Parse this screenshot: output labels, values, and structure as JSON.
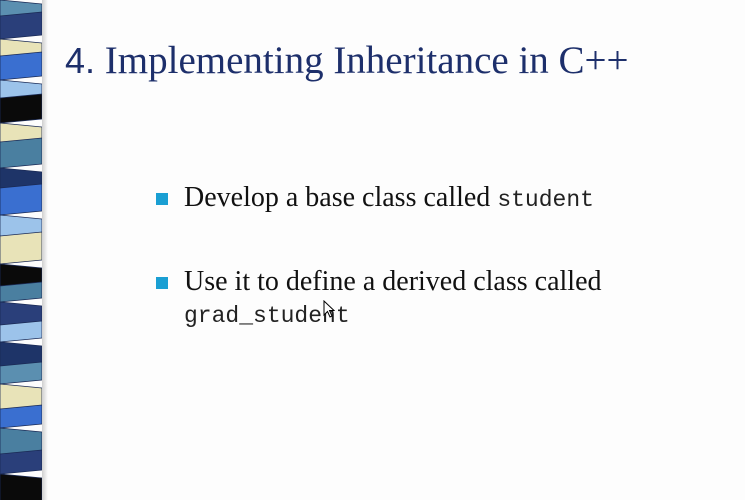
{
  "slide": {
    "title_number": "4.",
    "title_text": " Implementing Inheritance in C++",
    "bullets": [
      {
        "text": "Develop a base class called ",
        "code": "student"
      },
      {
        "text": "Use it to define a derived class called",
        "code": "grad_student"
      }
    ]
  },
  "colors": {
    "title": "#1d2f6b",
    "bullet_marker": "#1a9fd3",
    "stripes": [
      "#5b8fb0",
      "#2a3f7a",
      "#e8e3b8",
      "#3a6fd0",
      "#9cc3ea",
      "#0a0a0a",
      "#4a7fa0",
      "#1e3468"
    ]
  },
  "icons": {
    "pointer": "mouse-pointer-icon"
  }
}
